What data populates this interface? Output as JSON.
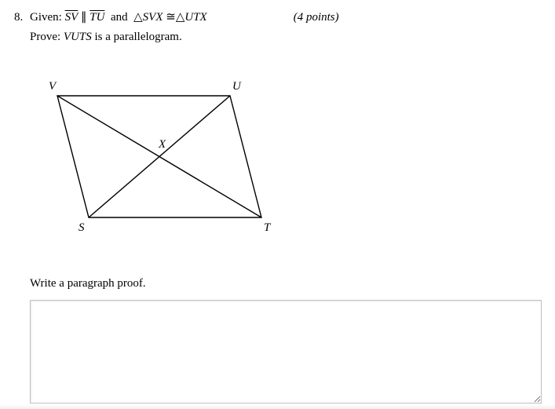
{
  "problem": {
    "number": "8.",
    "given_prefix": "Given:",
    "seg1": "SV",
    "parallel": "∥",
    "seg2": "TU",
    "and": "and",
    "tri_sym": "△",
    "tri1": "SVX",
    "cong": "≅",
    "tri2": "UTX",
    "points": "(4 points)",
    "prove_prefix": "Prove:",
    "prove_obj": "VUTS",
    "prove_rest": "is a parallelogram."
  },
  "figure": {
    "V": "V",
    "U": "U",
    "S": "S",
    "T": "T",
    "X": "X"
  },
  "instruction": "Write a paragraph proof.",
  "answer": {
    "placeholder": ""
  }
}
